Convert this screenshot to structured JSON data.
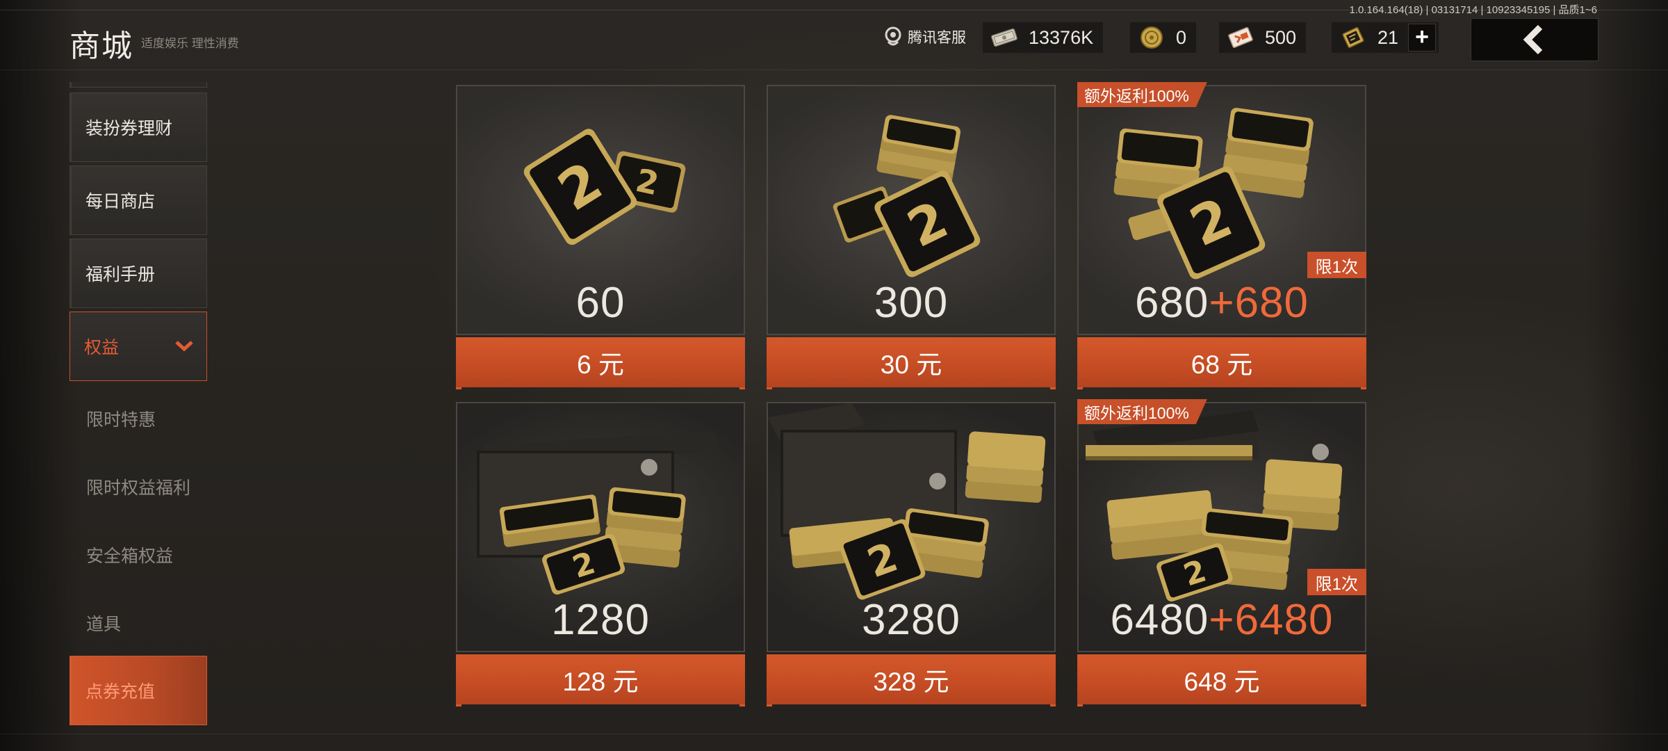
{
  "version": "1.0.164.164(18) | 03131714 | 10923345195 | 品质1~6",
  "header": {
    "title": "商城",
    "subtitle": "适度娱乐 理性消费",
    "service_label": "腾讯客服"
  },
  "currencies": [
    {
      "icon": "cash-bundle-icon",
      "value": "13376K"
    },
    {
      "icon": "gold-coin-icon",
      "value": "0"
    },
    {
      "icon": "voucher-ticket-icon",
      "value": "500"
    },
    {
      "icon": "coupon-bar-icon",
      "value": "21"
    }
  ],
  "sidebar": {
    "items": [
      {
        "label": "装扮券理财"
      },
      {
        "label": "每日商店"
      },
      {
        "label": "福利手册"
      }
    ],
    "expanded": {
      "label": "权益"
    },
    "sub_items": [
      {
        "label": "限时特惠"
      },
      {
        "label": "限时权益福利"
      },
      {
        "label": "安全箱权益"
      },
      {
        "label": "道具"
      }
    ],
    "active": {
      "label": "点券充值"
    }
  },
  "products": [
    {
      "amount": "60",
      "bonus": "",
      "price": "6 元",
      "badge": "",
      "limit": ""
    },
    {
      "amount": "300",
      "bonus": "",
      "price": "30 元",
      "badge": "",
      "limit": ""
    },
    {
      "amount": "680",
      "bonus": "+680",
      "price": "68 元",
      "badge": "额外返利100%",
      "limit": "限1次"
    },
    {
      "amount": "1280",
      "bonus": "",
      "price": "128 元",
      "badge": "",
      "limit": ""
    },
    {
      "amount": "3280",
      "bonus": "",
      "price": "328 元",
      "badge": "",
      "limit": ""
    },
    {
      "amount": "6480",
      "bonus": "+6480",
      "price": "648 元",
      "badge": "额外返利100%",
      "limit": "限1次"
    }
  ],
  "colors": {
    "accent": "#d4582b",
    "bonus": "#f0693a",
    "background": "#282521"
  }
}
